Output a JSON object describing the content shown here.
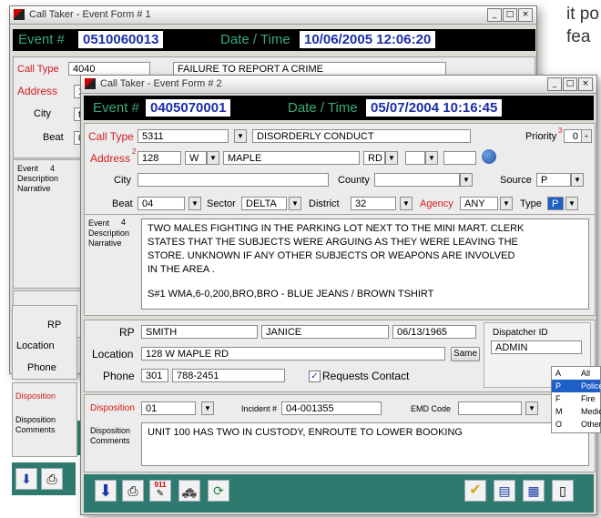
{
  "bg_text": {
    "line1": "it po",
    "line2": "fea"
  },
  "back_window": {
    "title": "Call Taker - Event Form # 1",
    "event_label": "Event #",
    "event_number": "0510060013",
    "datetime_label": "Date / Time",
    "datetime": "10/06/2005 12:06:20",
    "call_type_label": "Call Type",
    "call_type_code": "4040",
    "call_type_desc": "FAILURE TO REPORT A CRIME",
    "address_label": "Address",
    "address_partial": "1",
    "city_label": "City",
    "city_partial": "t",
    "beat_label": "Beat",
    "beat_partial": "0",
    "event_desc_label": "Event Description Narrative",
    "event_count": "4",
    "rp_label": "RP",
    "location_label": "Location",
    "phone_label": "Phone",
    "disposition_label": "Disposition",
    "disp_comments_label": "Disposition Comments"
  },
  "window": {
    "title": "Call Taker - Event Form # 2",
    "event_label": "Event #",
    "event_number": "0405070001",
    "datetime_label": "Date / Time",
    "datetime": "05/07/2004 10:16:45"
  },
  "form": {
    "call_type_label": "Call Type",
    "call_type_code": "5311",
    "call_type_desc": "DISORDERLY CONDUCT",
    "priority_label": "Priority",
    "priority_sup": "3",
    "priority_value": "0",
    "address_label": "Address",
    "address_sup": "2",
    "address_number": "128",
    "address_dir": "W",
    "address_street": "MAPLE",
    "address_suffix": "RD",
    "city_label": "City",
    "county_label": "County",
    "source_label": "Source",
    "source_value": "P",
    "beat_label": "Beat",
    "beat_value": "04",
    "sector_label": "Sector",
    "sector_value": "DELTA",
    "district_label": "District",
    "district_value": "32",
    "agency_label": "Agency",
    "agency_value": "ANY",
    "type_label": "Type",
    "type_value": "P",
    "event_desc_label": [
      "Event",
      "Description",
      "Narrative"
    ],
    "event_count": "4",
    "narrative_lines": [
      "TWO MALES FIGHTING IN THE PARKING LOT NEXT TO THE MINI MART.  CLERK",
      "STATES THAT THE SUBJECTS WERE ARGUING AS THEY WERE LEAVING THE",
      "STORE.  UNKNOWN IF ANY OTHER SUBJECTS OR WEAPONS ARE INVOLVED",
      "IN THE AREA .",
      "",
      "S#1 WMA,6-0,200,BRO,BRO - BLUE JEANS / BROWN TSHIRT"
    ],
    "type_options": [
      {
        "code": "A",
        "label": "All"
      },
      {
        "code": "P",
        "label": "Police"
      },
      {
        "code": "F",
        "label": "Fire"
      },
      {
        "code": "M",
        "label": "Medical"
      },
      {
        "code": "O",
        "label": "Other"
      }
    ],
    "rp_label": "RP",
    "rp_last": "SMITH",
    "rp_first": "JANICE",
    "rp_dob": "06/13/1965",
    "location_label": "Location",
    "location_value": "128 W MAPLE RD",
    "same_button": "Same",
    "phone_label": "Phone",
    "phone_area": "301",
    "phone_number": "788-2451",
    "requests_contact_label": "Requests Contact",
    "requests_contact_checked": true,
    "dispatcher_id_label": "Dispatcher ID",
    "dispatcher_id": "ADMIN",
    "disposition_label": "Disposition",
    "disposition_code": "01",
    "incident_label": "Incident #",
    "incident_number": "04-001355",
    "emd_label": "EMD Code",
    "disp_comments_label": [
      "Disposition",
      "Comments"
    ],
    "disp_comments": "UNIT 100 HAS TWO IN CUSTODY, ENROUTE TO LOWER BOOKING"
  },
  "toolbar": {
    "bg_color": "#2e7a6e",
    "icons": [
      "save-down-icon",
      "print-icon",
      "tools-911-icon",
      "vehicle-icon",
      "refresh-icon",
      "approve-check-icon",
      "clipboard-icon",
      "map-icon",
      "document-icon"
    ],
    "badge_911": "911"
  },
  "colors": {
    "accent_red": "#d41c1c",
    "event_number_blue": "#1a2ea8",
    "event_label_green": "#3aa87a"
  }
}
